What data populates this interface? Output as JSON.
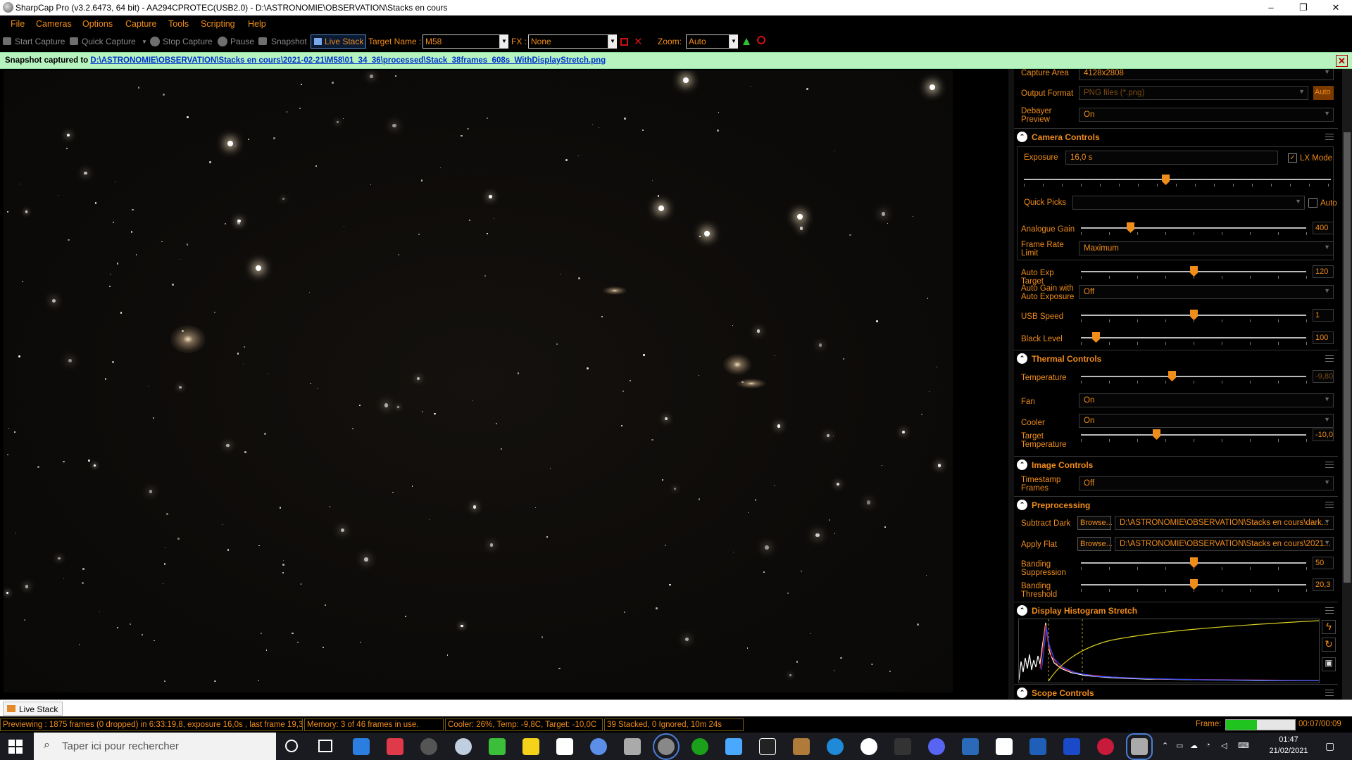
{
  "window": {
    "title": "SharpCap Pro (v3.2.6473, 64 bit) - AA294CPROTEC(USB2.0) - D:\\ASTRONOMIE\\OBSERVATION\\Stacks en cours",
    "minimize": "–",
    "maximize": "❐",
    "close": "✕"
  },
  "menu": [
    "File",
    "Cameras",
    "Options",
    "Capture",
    "Tools",
    "Scripting",
    "Help"
  ],
  "toolbar": {
    "start_capture": "Start Capture",
    "quick_capture": "Quick Capture",
    "stop_capture": "Stop Capture",
    "pause": "Pause",
    "snapshot": "Snapshot",
    "live_stack": "Live Stack",
    "target_name_label": "Target Name :",
    "target_name_value": "M58",
    "fx_label": "FX :",
    "fx_value": "None",
    "zoom_label": "Zoom:",
    "zoom_value": "Auto"
  },
  "notification": {
    "prefix": "Snapshot captured to",
    "path": "D:\\ASTRONOMIE\\OBSERVATION\\Stacks en cours\\2021-02-21\\M58\\01_34_36\\processed\\Stack_38frames_608s_WithDisplayStretch.png",
    "close": "✕"
  },
  "panel": {
    "capture_area": {
      "label": "Capture Area",
      "value": "4128x2808"
    },
    "output_format": {
      "label": "Output Format",
      "value": "PNG files (*.png)",
      "auto": "Auto"
    },
    "debayer_preview": {
      "label": "Debayer Preview",
      "value": "On"
    },
    "camera_controls": {
      "title": "Camera Controls",
      "exposure_label": "Exposure",
      "exposure_value": "16,0 s",
      "lx_mode": "LX Mode",
      "exposure_position": 0.46,
      "quick_picks_label": "Quick Picks",
      "quick_picks_value": "",
      "quick_picks_auto": "Auto",
      "analogue_gain": {
        "label": "Analogue Gain",
        "value": "400",
        "position": 0.21
      },
      "frame_rate_limit": {
        "label": "Frame Rate Limit",
        "value": "Maximum"
      },
      "auto_exp_target": {
        "label": "Auto Exp Target",
        "value": "120",
        "position": 0.5
      },
      "auto_gain": {
        "label": "Auto Gain with Auto Exposure",
        "value": "Off"
      },
      "usb_speed": {
        "label": "USB Speed",
        "value": "1",
        "position": 0.5
      },
      "black_level": {
        "label": "Black Level",
        "value": "100",
        "position": 0.05
      }
    },
    "thermal_controls": {
      "title": "Thermal Controls",
      "temperature": {
        "label": "Temperature",
        "value": "-9,80",
        "position": 0.4
      },
      "fan": {
        "label": "Fan",
        "value": "On"
      },
      "cooler": {
        "label": "Cooler",
        "value": "On"
      },
      "target_temperature": {
        "label": "Target Temperature",
        "value": "-10,0",
        "position": 0.33
      }
    },
    "image_controls": {
      "title": "Image Controls",
      "timestamp_frames": {
        "label": "Timestamp Frames",
        "value": "Off"
      }
    },
    "preprocessing": {
      "title": "Preprocessing",
      "subtract_dark": {
        "label": "Subtract Dark",
        "browse": "Browse...",
        "value": "D:\\ASTRONOMIE\\OBSERVATION\\Stacks en cours\\dark..."
      },
      "apply_flat": {
        "label": "Apply Flat",
        "browse": "Browse...",
        "value": "D:\\ASTRONOMIE\\OBSERVATION\\Stacks en cours\\2021..."
      },
      "banding_suppression": {
        "label": "Banding Suppression",
        "value": "50",
        "position": 0.5
      },
      "banding_threshold": {
        "label": "Banding Threshold",
        "value": "20,3",
        "position": 0.5
      }
    },
    "histogram": {
      "title": "Display Histogram Stretch"
    },
    "scope_controls": {
      "title": "Scope Controls"
    }
  },
  "bottom_tab": "Live Stack",
  "status": {
    "previewing": "Previewing : 1875 frames (0 dropped) in 6:33:19,8, exposure 16,0s , last frame 19,3",
    "memory": "Memory: 3 of 46 frames in use.",
    "cooler": "Cooler: 26%, Temp: -9,8C, Target: -10,0C",
    "stacked": "39 Stacked, 0 Ignored, 10m 24s",
    "frame_label": "Frame:",
    "frame_progress": 0.45,
    "frame_time": "00:07/00:09"
  },
  "taskbar": {
    "search_placeholder": "Taper ici pour rechercher",
    "time": "01:47",
    "date": "21/02/2021"
  },
  "colors": {
    "accent": "#f08c1a",
    "notification": "#b6f3bf",
    "link": "#0033cc"
  }
}
